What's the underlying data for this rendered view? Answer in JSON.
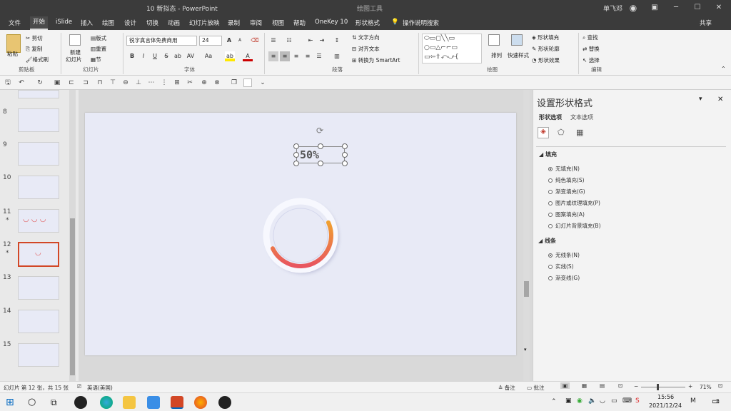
{
  "titlebar": {
    "doc_title": "10 新拟态 - PowerPoint",
    "context_group": "绘图工具",
    "user": "单飞邓",
    "share": "共享",
    "icons": {
      "minimize": "─",
      "maximize": "☐",
      "close": "✕",
      "ribbon_display": "▣",
      "user_avatar": "◉"
    }
  },
  "tabs": [
    "文件",
    "开始",
    "iSlide",
    "插入",
    "绘图",
    "设计",
    "切换",
    "动画",
    "幻灯片放映",
    "录制",
    "审阅",
    "视图",
    "帮助",
    "OneKey 10",
    "形状格式"
  ],
  "active_tab": "开始",
  "tell_me": "操作说明搜索",
  "ribbon": {
    "clipboard": {
      "paste": "粘贴",
      "cut": "剪切",
      "copy": "复制",
      "format_painter": "格式刷",
      "group": "剪贴板"
    },
    "slides": {
      "new_slide_1": "新建",
      "new_slide_2": "幻灯片",
      "layout": "版式",
      "reset": "重置",
      "section": "节",
      "group": "幻灯片"
    },
    "font": {
      "name": "锐字真言体免费商用",
      "size": "24",
      "bold": "B",
      "italic": "I",
      "underline": "U",
      "strike": "S",
      "shadow": "ab",
      "spacing": "AV",
      "case": "Aa",
      "grow": "A",
      "shrink": "A",
      "color": "A",
      "group": "字体"
    },
    "paragraph": {
      "text_direction": "文字方向",
      "align_text": "对齐文本",
      "smartart": "转换为 SmartArt",
      "group": "段落"
    },
    "drawing": {
      "arrange": "排列",
      "quick_styles": "快速样式",
      "fill": "形状填充",
      "outline": "形状轮廓",
      "effects": "形状效果",
      "group": "绘图"
    },
    "editing": {
      "find": "查找",
      "replace": "替换",
      "select": "选择",
      "group": "编辑"
    }
  },
  "slides": [
    {
      "num": "8",
      "star": ""
    },
    {
      "num": "9",
      "star": ""
    },
    {
      "num": "10",
      "star": ""
    },
    {
      "num": "11",
      "star": "*"
    },
    {
      "num": "12",
      "star": "*"
    },
    {
      "num": "13",
      "star": ""
    },
    {
      "num": "14",
      "star": ""
    },
    {
      "num": "15",
      "star": ""
    }
  ],
  "canvas": {
    "textbox": "50%",
    "progress_value": 0.5,
    "gradient_start": "#f0a030",
    "gradient_end": "#e85560",
    "slide_bg": "#e8eaf6"
  },
  "pane": {
    "title": "设置形状格式",
    "tab_shape": "形状选项",
    "tab_text": "文本选项",
    "fill_header": "填充",
    "fill_options": [
      "无填充(N)",
      "纯色填充(S)",
      "渐变填充(G)",
      "图片或纹理填充(P)",
      "图案填充(A)",
      "幻灯片背景填充(B)"
    ],
    "line_header": "线条",
    "line_options": [
      "无线条(N)",
      "实线(S)",
      "渐变线(G)"
    ]
  },
  "status": {
    "slide_info": "幻灯片 第 12 张，共 15 张",
    "language": "英语(美国)",
    "notes": "备注",
    "comments": "批注",
    "zoom": "71%"
  },
  "taskbar": {
    "time": "15:56",
    "date": "2021/12/24",
    "notification_count": "2"
  }
}
